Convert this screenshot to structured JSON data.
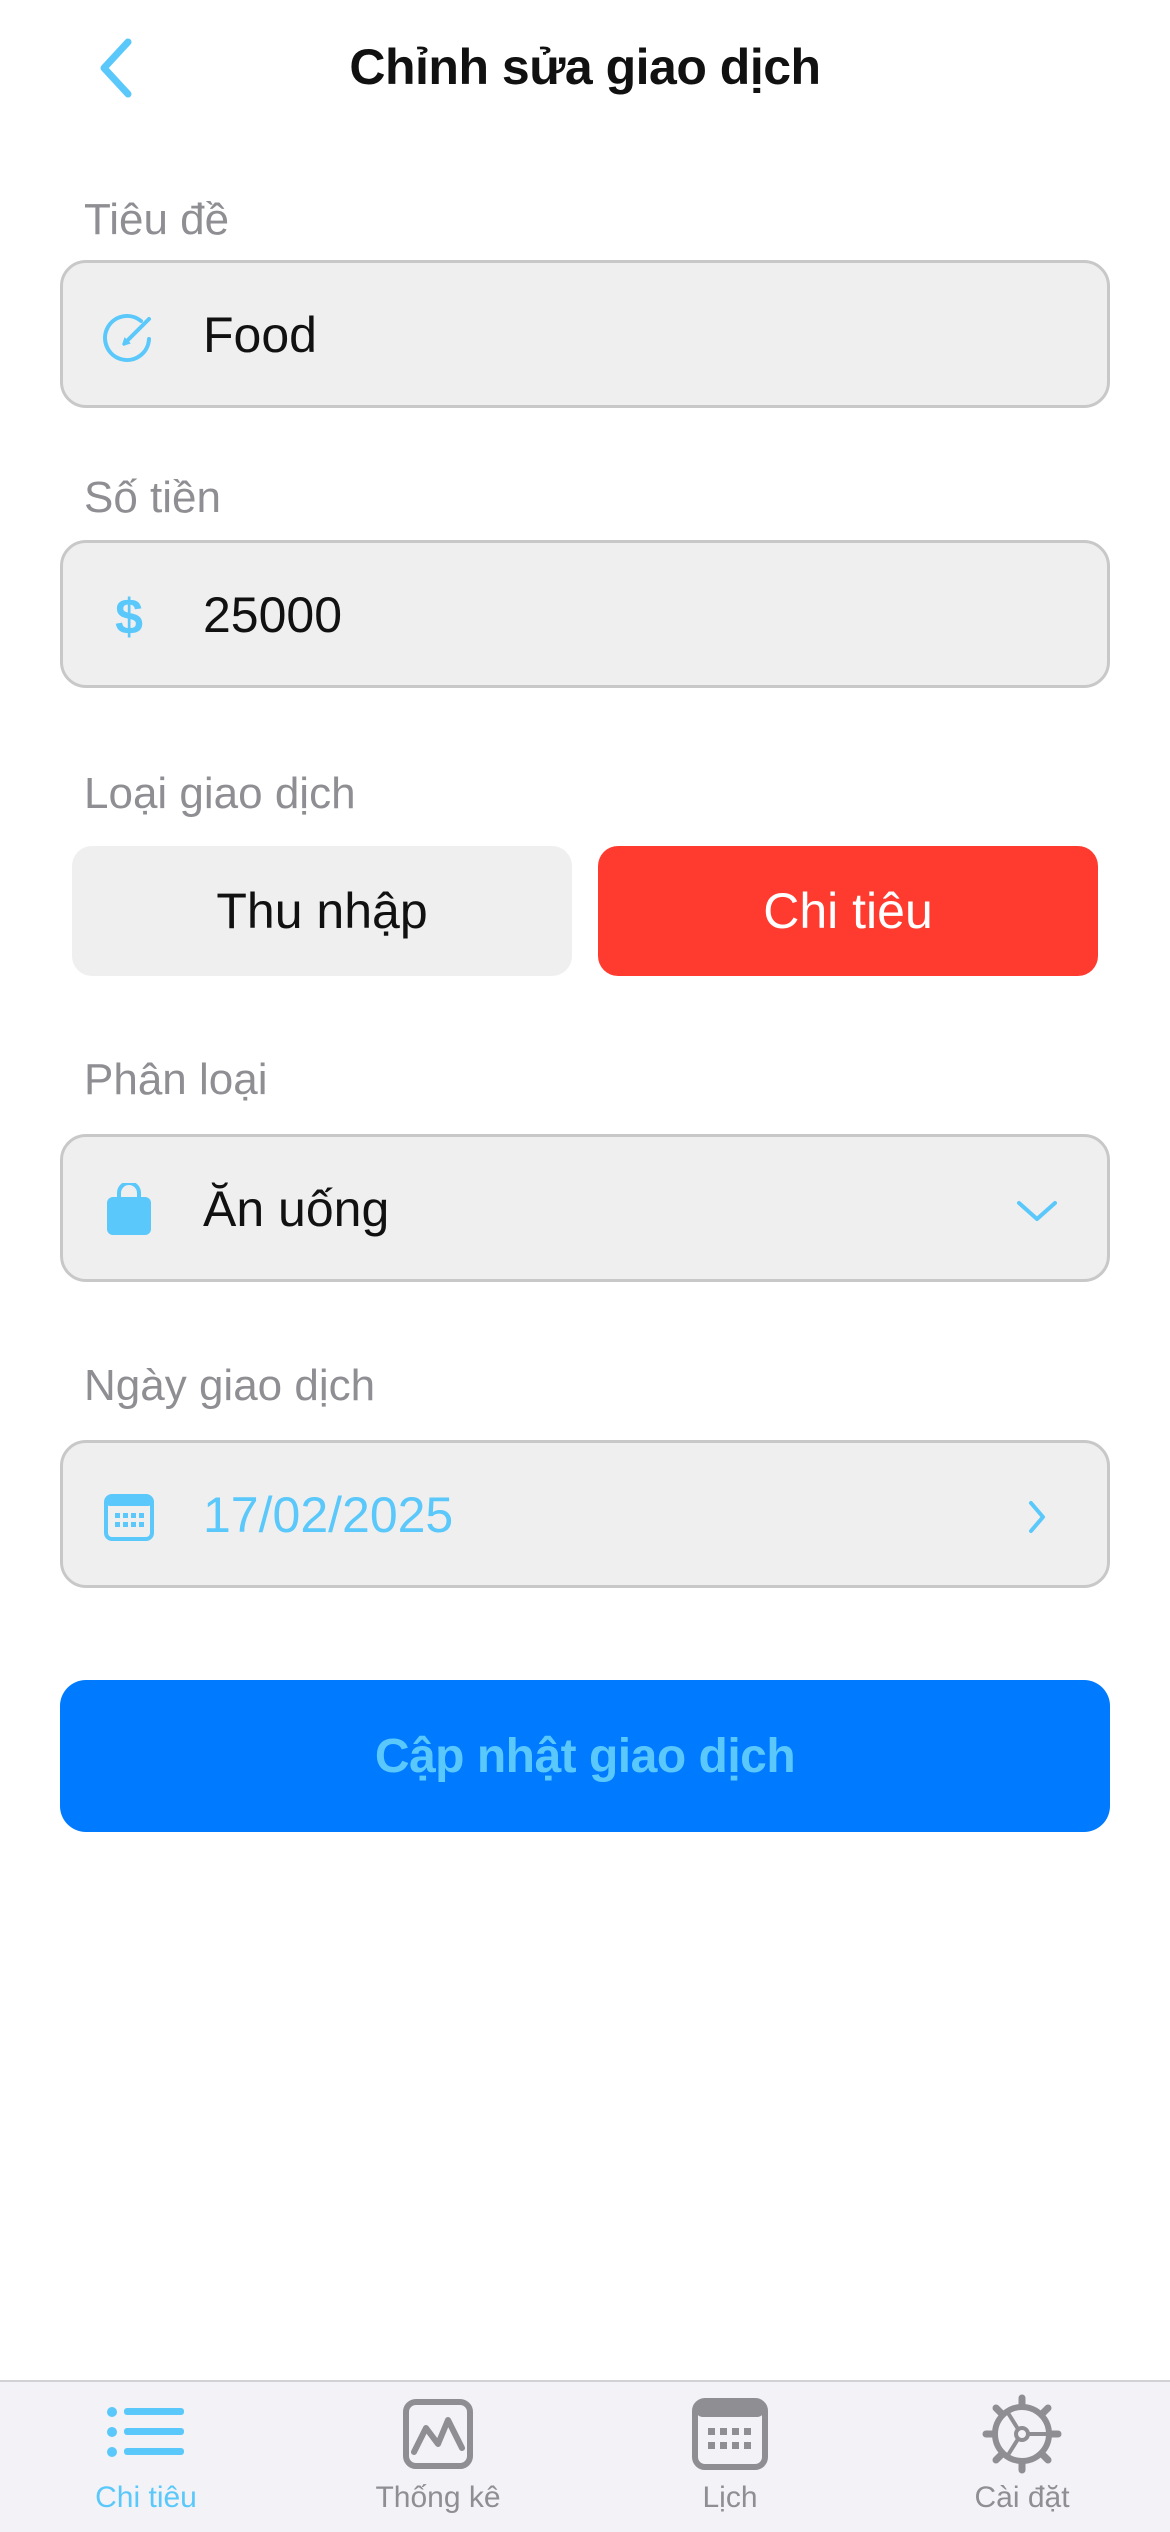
{
  "header": {
    "title": "Chỉnh sửa giao dịch",
    "back_icon": "chevron-left-icon"
  },
  "form": {
    "title_field": {
      "label": "Tiêu đề",
      "value": "Food",
      "icon": "edit-circle-icon"
    },
    "amount_field": {
      "label": "Số tiền",
      "value": "25000",
      "symbol": "$"
    },
    "type": {
      "label": "Loại giao dịch",
      "options": [
        "Thu nhập",
        "Chi tiêu"
      ],
      "selected": "Chi tiêu"
    },
    "category": {
      "label": "Phân loại",
      "value": "Ăn uống",
      "icon": "bag-icon"
    },
    "date": {
      "label": "Ngày giao dịch",
      "value": "17/02/2025",
      "icon": "calendar-icon"
    },
    "submit_label": "Cập nhật giao dịch"
  },
  "tabbar": {
    "tabs": [
      {
        "label": "Chi tiêu",
        "icon": "list-icon",
        "active": true
      },
      {
        "label": "Thống kê",
        "icon": "chart-icon",
        "active": false
      },
      {
        "label": "Lịch",
        "icon": "calendar-icon",
        "active": false
      },
      {
        "label": "Cài đặt",
        "icon": "gear-icon",
        "active": false
      }
    ]
  },
  "colors": {
    "accent": "#5ac8fa",
    "primary_button": "#007aff",
    "expense": "#ff3b30",
    "field_background": "#efefef",
    "label_gray": "#8e8e93"
  }
}
